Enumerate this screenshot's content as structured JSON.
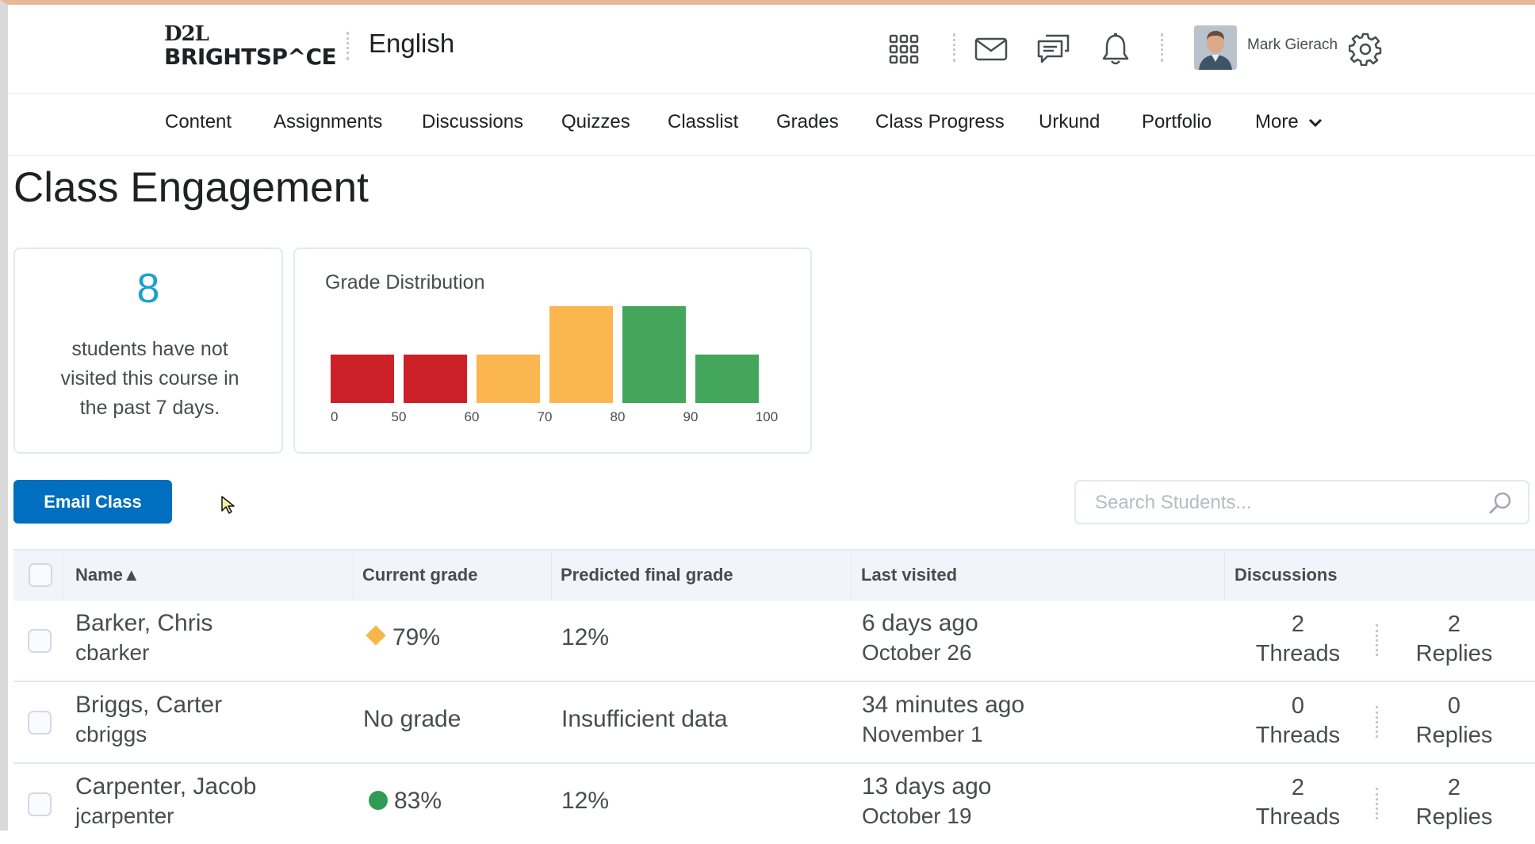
{
  "header": {
    "logo_top": "D2L",
    "logo_bottom": "BRIGHTSP^CE",
    "course_name": "English",
    "icons": [
      "waffle-icon",
      "mail-icon",
      "chat-icon",
      "bell-icon",
      "gear-icon"
    ],
    "user_name": "Mark Gierach"
  },
  "nav": {
    "items": [
      "Content",
      "Assignments",
      "Discussions",
      "Quizzes",
      "Classlist",
      "Grades",
      "Class Progress",
      "Urkund",
      "Portfolio"
    ],
    "more_label": "More"
  },
  "page": {
    "title": "Class Engagement"
  },
  "summary_card": {
    "count": "8",
    "text": "students have not visited this course in the past 7 days."
  },
  "chart_data": {
    "type": "bar",
    "title": "Grade Distribution",
    "tick_labels": [
      "0",
      "50",
      "60",
      "70",
      "80",
      "90",
      "100"
    ],
    "bins": [
      "0-50",
      "50-60",
      "60-70",
      "70-80",
      "80-90",
      "90-100"
    ],
    "values": [
      1,
      1,
      1,
      2,
      2,
      1
    ],
    "colors": [
      "#cc2029",
      "#cc2029",
      "#fbb650",
      "#fbb650",
      "#43a65a",
      "#43a65a"
    ],
    "grid": false
  },
  "toolbar": {
    "email_label": "Email Class",
    "search_placeholder": "Search Students..."
  },
  "table": {
    "headers": {
      "name": "Name▲",
      "current_grade": "Current grade",
      "predicted": "Predicted final grade",
      "last_visited": "Last visited",
      "discussions": "Discussions"
    },
    "rows": [
      {
        "name": "Barker, Chris",
        "username": "cbarker",
        "grade": "79%",
        "grade_marker": "diamond",
        "predicted": "12%",
        "last_visited": "6 days ago",
        "last_visited_date": "October 26",
        "threads": "2",
        "threads_label": "Threads",
        "replies": "2",
        "replies_label": "Replies"
      },
      {
        "name": "Briggs, Carter",
        "username": "cbriggs",
        "grade": "No grade",
        "grade_marker": "none",
        "predicted": "Insufficient data",
        "last_visited": "34 minutes ago",
        "last_visited_date": "November 1",
        "threads": "0",
        "threads_label": "Threads",
        "replies": "0",
        "replies_label": "Replies"
      },
      {
        "name": "Carpenter, Jacob",
        "username": "jcarpenter",
        "grade": "83%",
        "grade_marker": "circle",
        "predicted": "12%",
        "last_visited": "13 days ago",
        "last_visited_date": "October 19",
        "threads": "2",
        "threads_label": "Threads",
        "replies": "2",
        "replies_label": "Replies"
      }
    ]
  },
  "colors": {
    "primary_button": "#006fbf",
    "accent_count": "#1ca0d0",
    "grade_warning": "#f7b748",
    "grade_good": "#2f9b57"
  }
}
